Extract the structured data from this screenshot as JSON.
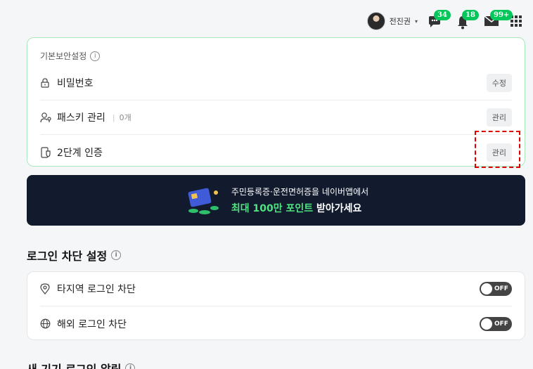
{
  "header": {
    "username": "전진권",
    "caret": "▾",
    "chat_badge": "34",
    "notification_badge": "18",
    "mail_badge": "99+"
  },
  "basic_security": {
    "title": "기본보안설정",
    "rows": [
      {
        "label": "비밀번호",
        "button": "수정",
        "icon": "lock-icon"
      },
      {
        "label": "패스키 관리",
        "sub": "0개",
        "button": "관리",
        "icon": "passkey-icon"
      },
      {
        "label": "2단계 인증",
        "button": "관리",
        "icon": "phone-shield-icon"
      }
    ]
  },
  "banner": {
    "line1": "주민등록증·운전면허증을 네이버앱에서",
    "line2_highlight": "최대 100만 포인트",
    "line2_rest": " 받아가세요"
  },
  "login_block": {
    "title": "로그인 차단 설정",
    "rows": [
      {
        "label": "타지역 로그인 차단",
        "toggle": "OFF",
        "icon": "location-pin-icon"
      },
      {
        "label": "해외 로그인 차단",
        "toggle": "OFF",
        "icon": "globe-icon"
      }
    ]
  },
  "new_device": {
    "title": "새 기기 로그인 알림"
  },
  "colors": {
    "accent": "#03c75a",
    "banner_bg": "#121a2e",
    "highlight_border": "#e00000"
  }
}
